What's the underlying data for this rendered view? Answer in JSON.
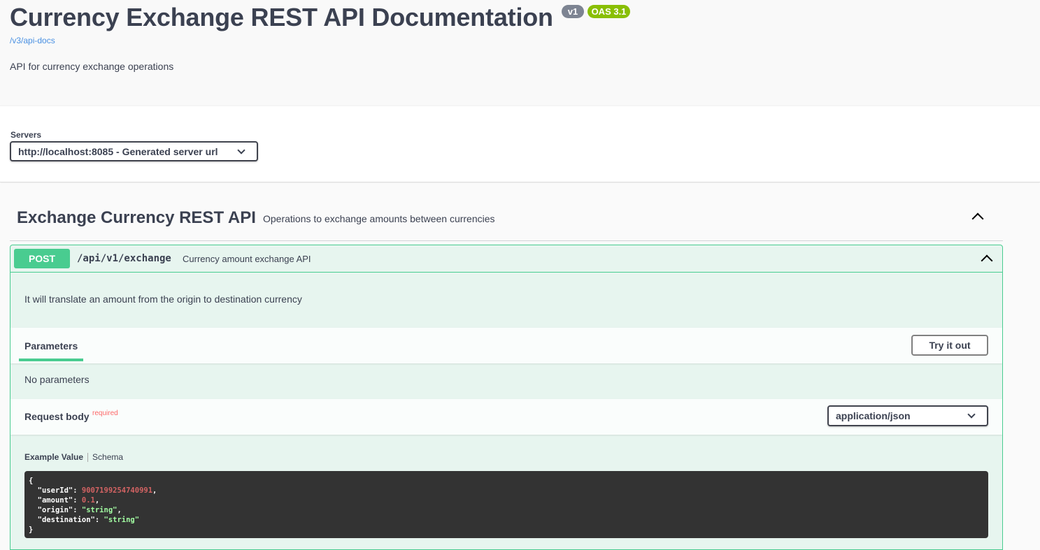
{
  "info": {
    "title": "Currency Exchange REST API Documentation",
    "version_badge": "v1",
    "oas_badge": "OAS 3.1",
    "api_docs_link": "/v3/api-docs",
    "description": "API for currency exchange operations"
  },
  "servers": {
    "label": "Servers",
    "selected": "http://localhost:8085 - Generated server url"
  },
  "tag": {
    "name": "Exchange Currency REST API",
    "description": "Operations to exchange amounts between currencies",
    "expanded": true
  },
  "operation": {
    "method": "POST",
    "path": "/api/v1/exchange",
    "summary": "Currency amount exchange API",
    "description": "It will translate an amount from the origin to destination currency",
    "parameters_tab": "Parameters",
    "try_button": "Try it out",
    "no_parameters": "No parameters",
    "request_body_label": "Request body",
    "required_label": "required",
    "content_type": "application/json",
    "example_tab": "Example Value",
    "schema_tab": "Schema",
    "example": {
      "open": "{",
      "close": "}",
      "fields": [
        {
          "key": "\"userId\"",
          "value": "9007199254740991",
          "suffix": ",",
          "type": "number"
        },
        {
          "key": "\"amount\"",
          "value": "0.1",
          "suffix": ",",
          "type": "number"
        },
        {
          "key": "\"origin\"",
          "value": "\"string\"",
          "suffix": ",",
          "type": "string"
        },
        {
          "key": "\"destination\"",
          "value": "\"string\"",
          "suffix": "",
          "type": "string"
        }
      ]
    }
  },
  "colors": {
    "post": "#49cc90",
    "text": "#3b4151",
    "badge_version": "#7d8492",
    "badge_oas": "#89bf04",
    "link": "#4990e2",
    "code_bg": "#333333",
    "code_number": "#d36363",
    "code_string": "#a2fca2"
  },
  "icons": {
    "servers_dropdown": "chevron-down-icon",
    "tag_toggle": "chevron-up-icon",
    "op_toggle": "chevron-up-icon",
    "content_dropdown": "chevron-down-icon"
  }
}
